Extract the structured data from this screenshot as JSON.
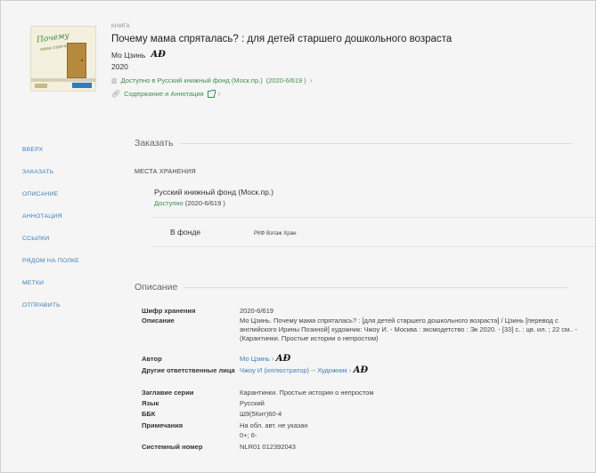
{
  "record": {
    "doc_type": "КНИГА",
    "title": "Почему мама спряталась? : для детей старшего дошкольного возраста",
    "author": "Мо Цзинь",
    "author_icon": "authority-ad-icon",
    "year": "2020",
    "availability_link": "Доступно в Русский книжный фонд (Моск.пр.)",
    "availability_code": "(2020-6/619 )",
    "contents_link": "Содержание и Аннотация",
    "cover_text_1": "Почему",
    "cover_text_2": "мама спряталась?"
  },
  "side_nav": [
    "ВВЕРХ",
    "ЗАКАЗАТЬ",
    "ОПИСАНИЕ",
    "АННОТАЦИЯ",
    "ССЫЛКИ",
    "РЯДОМ НА ПОЛКЕ",
    "МЕТКИ",
    "ОТПРАВИТЬ"
  ],
  "order": {
    "heading": "Заказать",
    "storage_label": "МЕСТА ХРАНЕНИЯ",
    "location_name": "Русский книжный фонд (Моск.пр.)",
    "status_available": "Доступно",
    "status_code": "(2020-6/619 )",
    "fund_label": "В фонде",
    "fund_place": "РКФ Вэтаж Хран"
  },
  "description": {
    "heading": "Описание",
    "rows": [
      {
        "label": "Шифр хранения",
        "value": "2020-6/619"
      },
      {
        "label": "Описание",
        "value": "Мо Цзинь. Почему мама спряталась? : [для детей старшего дошкольного возраста] / Цзинь [перевод с английского Ирины Позиной] художник: Чжоу И. - Москва : эксмодетство : Эк 2020. - [33] с. : цв. ил. ; 22 см.. - (Карантинки. Простые истории о непростом)"
      },
      {
        "label": "Автор",
        "value": "Мо Цзинь"
      },
      {
        "label": "Другие ответственные лица",
        "value": "Чжоу И (иллюстратор) -- Художник"
      },
      {
        "label": "Заглавие серии",
        "value": "Карантинки. Простые истории о непростом"
      },
      {
        "label": "Язык",
        "value": "Русский"
      },
      {
        "label": "ББК",
        "value": "Ш9(5Кит)60-4"
      },
      {
        "label": "Примечания",
        "value": "На обл. авт. не указан",
        "value2": "0+; 6-"
      },
      {
        "label": "Системный номер",
        "value": "NLR01 012392043"
      }
    ]
  },
  "colors": {
    "link_green": "#3f8f4b",
    "link_blue": "#3a7fb8",
    "background": "#f5f5f5"
  }
}
